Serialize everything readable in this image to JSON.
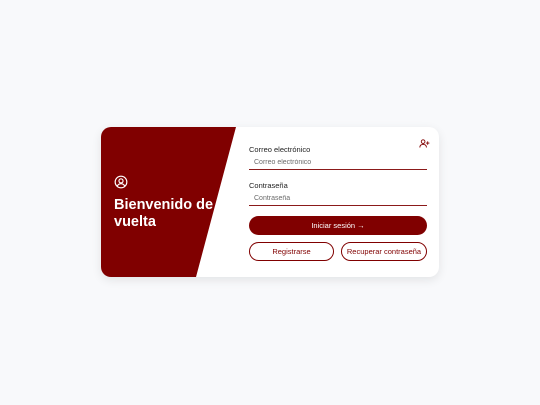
{
  "colors": {
    "brand": "#800000",
    "page_background": "#f8f9fb",
    "card_background": "#ffffff"
  },
  "welcome_panel": {
    "icon": "user-circle-icon",
    "title": "Bienvenido de vuelta"
  },
  "form": {
    "header_icon": "add-user-icon",
    "email": {
      "label": "Correo electrónico",
      "placeholder": "Correo electrónico",
      "value": ""
    },
    "password": {
      "label": "Contraseña",
      "placeholder": "Contraseña",
      "value": ""
    },
    "login_button": "Iniciar sesión →",
    "register_button": "Registrarse",
    "recover_button": "Recuperar contraseña"
  }
}
